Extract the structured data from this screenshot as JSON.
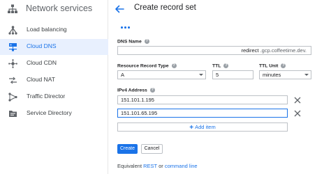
{
  "sidebar": {
    "title": "Network services",
    "items": [
      {
        "label": "Load balancing",
        "icon": "load-balancing-icon"
      },
      {
        "label": "Cloud DNS",
        "icon": "cloud-dns-icon",
        "active": true
      },
      {
        "label": "Cloud CDN",
        "icon": "cloud-cdn-icon"
      },
      {
        "label": "Cloud NAT",
        "icon": "cloud-nat-icon"
      },
      {
        "label": "Traffic Director",
        "icon": "traffic-director-icon"
      },
      {
        "label": "Service Directory",
        "icon": "service-directory-icon"
      }
    ]
  },
  "page": {
    "title": "Create record set"
  },
  "form": {
    "dns_name_label": "DNS Name",
    "dns_name_value": "redirect",
    "dns_name_suffix": ".gcp.coffeetime.dev.",
    "record_type_label": "Resource Record Type",
    "record_type_value": "A",
    "ttl_label": "TTL",
    "ttl_value": "5",
    "ttl_unit_label": "TTL Unit",
    "ttl_unit_value": "minutes",
    "ipv4_label": "IPv4 Address",
    "ipv4_values": [
      "151.101.1.195",
      "151.101.65.195"
    ],
    "add_item_label": "Add item"
  },
  "actions": {
    "create_label": "Create",
    "cancel_label": "Cancel"
  },
  "footer": {
    "prefix": "Equivalent",
    "rest_label": "REST",
    "or_text": "or",
    "cli_label": "command line"
  },
  "colors": {
    "accent": "#1a73e8",
    "active_bg": "#e8f0fe"
  }
}
